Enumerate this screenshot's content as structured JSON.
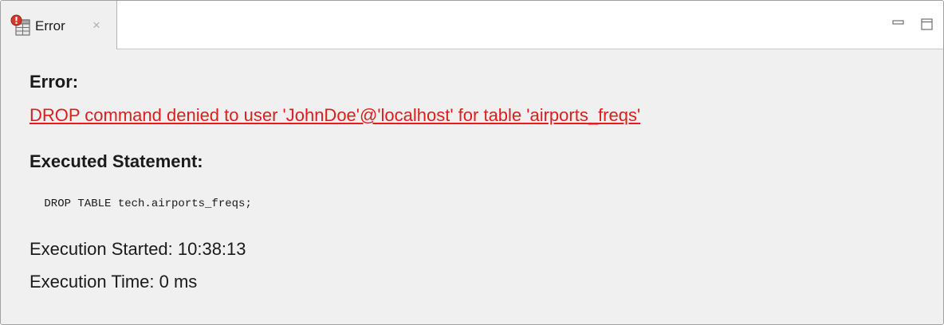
{
  "tab": {
    "label": "Error",
    "close_glyph": "×",
    "icon": "error-table-icon"
  },
  "window_controls": {
    "minimize_icon": "minimize-icon",
    "maximize_icon": "maximize-icon"
  },
  "error": {
    "heading": "Error:",
    "message": "DROP command denied to user 'JohnDoe'@'localhost' for table 'airports_freqs'"
  },
  "statement": {
    "heading": "Executed Statement:",
    "sql": " DROP TABLE tech.airports_freqs;"
  },
  "execution": {
    "started": "Execution Started: 10:38:13",
    "time": "Execution Time: 0 ms"
  },
  "colors": {
    "error_text": "#e01c1c",
    "panel_bg": "#f0f0f0",
    "tabbar_bg": "#ffffff"
  }
}
